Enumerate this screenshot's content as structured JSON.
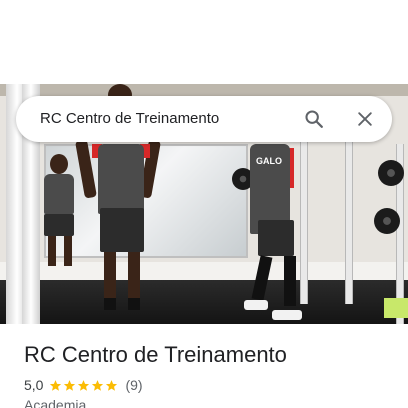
{
  "search": {
    "query": "RC Centro de Treinamento"
  },
  "icons": {
    "search": "search-icon",
    "close": "close-icon",
    "star": "star-icon"
  },
  "hero_photo": {
    "description_kind": "photo",
    "shirt_print": "GALO"
  },
  "place": {
    "name": "RC Centro de Treinamento",
    "rating": "5,0",
    "rating_stars": 5,
    "reviews": "(9)",
    "category": "Academia"
  },
  "colors": {
    "star": "#fbbc04",
    "icon": "#5f6368",
    "title": "#202124",
    "secondary": "#5f6368"
  }
}
